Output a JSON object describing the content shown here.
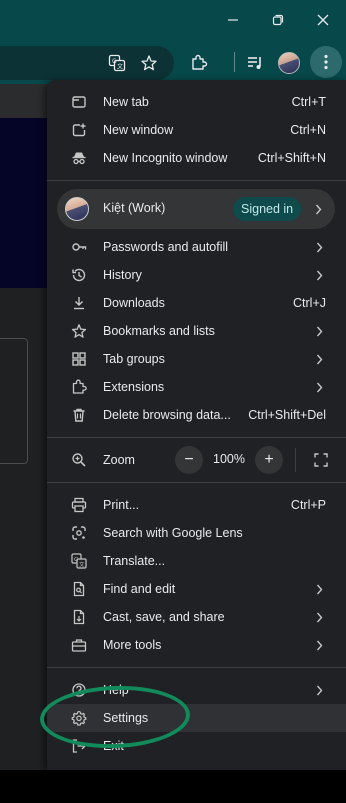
{
  "window": {
    "minimize_icon": "minimize-icon",
    "restore_icon": "restore-icon",
    "close_icon": "close-icon"
  },
  "toolbar": {
    "icons": [
      "translate-icon",
      "star-icon",
      "extensions-icon",
      "media-icon",
      "avatar",
      "kebab-icon"
    ]
  },
  "menu": {
    "new_tab": {
      "label": "New tab",
      "shortcut": "Ctrl+T"
    },
    "new_window": {
      "label": "New window",
      "shortcut": "Ctrl+N"
    },
    "new_incognito": {
      "label": "New Incognito window",
      "shortcut": "Ctrl+Shift+N"
    },
    "profile": {
      "name": "Kiệt (Work)",
      "badge": "Signed in"
    },
    "passwords": {
      "label": "Passwords and autofill"
    },
    "history": {
      "label": "History"
    },
    "downloads": {
      "label": "Downloads",
      "shortcut": "Ctrl+J"
    },
    "bookmarks": {
      "label": "Bookmarks and lists"
    },
    "tab_groups": {
      "label": "Tab groups"
    },
    "extensions": {
      "label": "Extensions"
    },
    "delete_data": {
      "label": "Delete browsing data...",
      "shortcut": "Ctrl+Shift+Del"
    },
    "zoom": {
      "label": "Zoom",
      "value": "100%",
      "minus": "−",
      "plus": "+"
    },
    "print": {
      "label": "Print...",
      "shortcut": "Ctrl+P"
    },
    "lens": {
      "label": "Search with Google Lens"
    },
    "translate": {
      "label": "Translate..."
    },
    "find_edit": {
      "label": "Find and edit"
    },
    "cast_save": {
      "label": "Cast, save, and share"
    },
    "more_tools": {
      "label": "More tools"
    },
    "help": {
      "label": "Help"
    },
    "settings": {
      "label": "Settings"
    },
    "exit": {
      "label": "Exit"
    }
  },
  "colors": {
    "title_bar": "#07484a",
    "menu_bg": "#202124",
    "annotation_oval": "#128a5b"
  }
}
